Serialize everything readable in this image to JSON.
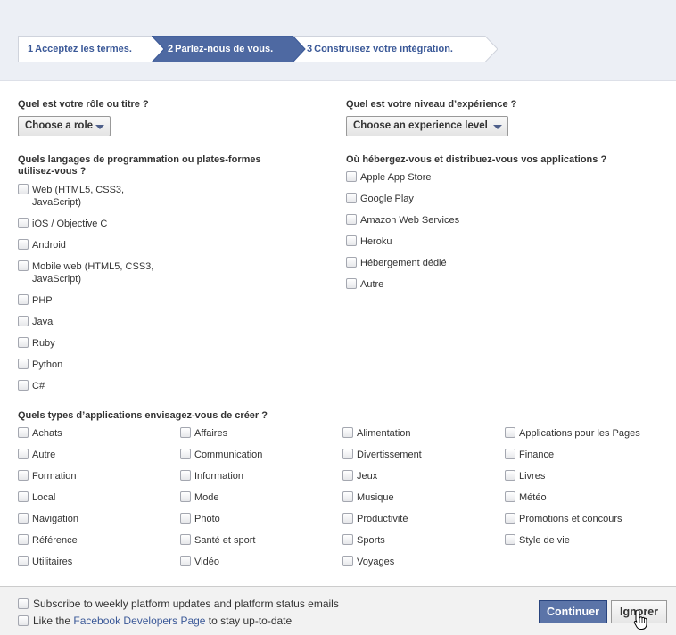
{
  "steps": [
    {
      "number": "1",
      "label": "Acceptez les termes."
    },
    {
      "number": "2",
      "label": "Parlez-nous de vous."
    },
    {
      "number": "3",
      "label": "Construisez votre intégration."
    }
  ],
  "role": {
    "question": "Quel est votre rôle ou titre ?",
    "dropdown": "Choose a role"
  },
  "experience": {
    "question": "Quel est votre niveau d’expérience ?",
    "dropdown": "Choose an experience level"
  },
  "languages": {
    "question_line1": "Quels langages de programmation ou plates-formes",
    "question_line2": "utilisez-vous ?",
    "options": [
      "Web (HTML5, CSS3, JavaScript)",
      "iOS / Objective C",
      "Android",
      "Mobile web (HTML5, CSS3, JavaScript)",
      "PHP",
      "Java",
      "Ruby",
      "Python",
      "C#"
    ]
  },
  "hosting": {
    "question": "Où hébergez-vous et distribuez-vous vos applications ?",
    "options": [
      "Apple App Store",
      "Google Play",
      "Amazon Web Services",
      "Heroku",
      "Hébergement dédié",
      "Autre"
    ]
  },
  "app_types": {
    "question": "Quels types d’applications envisagez-vous de créer ?",
    "columns": [
      [
        "Achats",
        "Autre",
        "Formation",
        "Local",
        "Navigation",
        "Référence",
        "Utilitaires"
      ],
      [
        "Affaires",
        "Communication",
        "Information",
        "Mode",
        "Photo",
        "Santé et sport",
        "Vidéo"
      ],
      [
        "Alimentation",
        "Divertissement",
        "Jeux",
        "Musique",
        "Productivité",
        "Sports",
        "Voyages"
      ],
      [
        "Applications pour les Pages",
        "Finance",
        "Livres",
        "Météo",
        "Promotions et concours",
        "Style de vie"
      ]
    ]
  },
  "footer": {
    "subscribe_label": "Subscribe to weekly platform updates and platform status emails",
    "like_prefix": "Like the ",
    "like_link": "Facebook Developers Page",
    "like_suffix": " to stay up-to-date",
    "continue_button": "Continuer",
    "ignore_button": "Ignorer"
  },
  "colors": {
    "brand_blue": "#3b5998",
    "active_step": "#4e69a2",
    "header_bg": "#eceff5"
  }
}
